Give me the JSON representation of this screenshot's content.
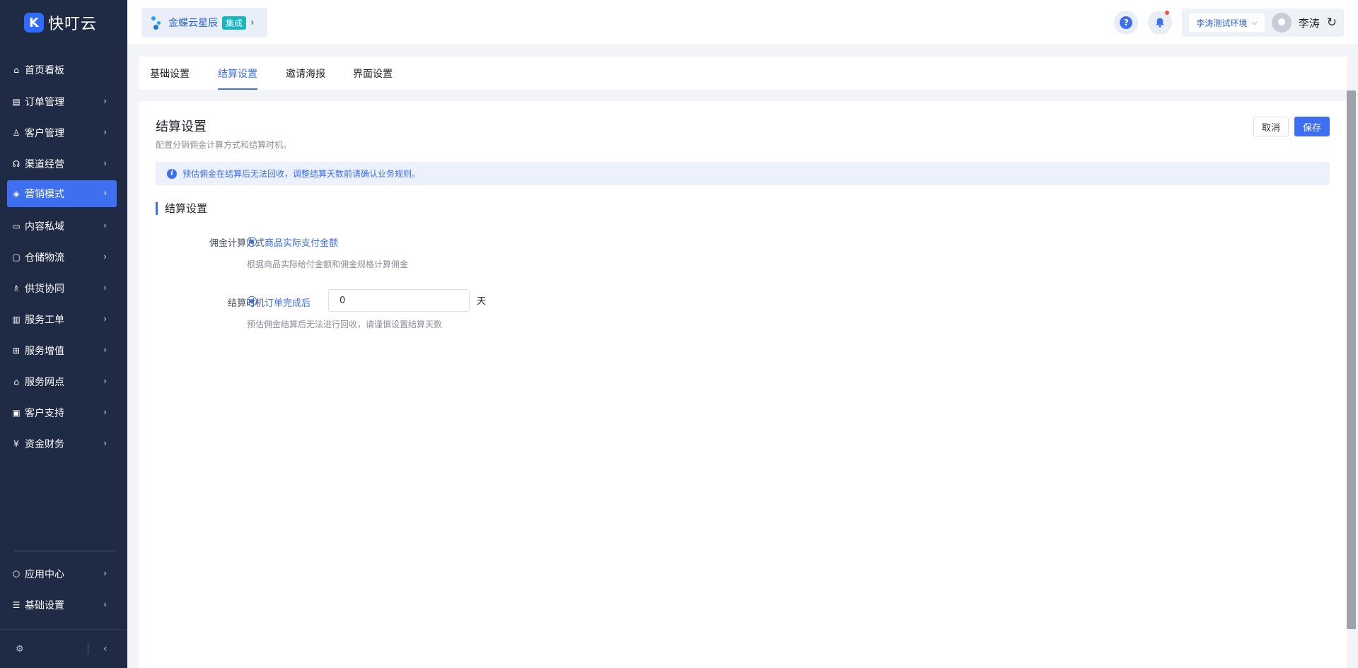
{
  "app": {
    "name": "快叮云",
    "logo_letter": "K"
  },
  "org": {
    "name": "金蝶云星辰",
    "badge": "集成"
  },
  "header": {
    "help_glyph": "?",
    "environment": "李涛测试环境",
    "user_name": "李涛"
  },
  "sidebar": {
    "items": [
      {
        "label": "首页看板",
        "icon": "home-icon",
        "has_children": false
      },
      {
        "label": "订单管理",
        "icon": "clipboard-icon",
        "has_children": true
      },
      {
        "label": "客户管理",
        "icon": "user-icon",
        "has_children": true
      },
      {
        "label": "渠道经营",
        "icon": "channel-icon",
        "has_children": true
      },
      {
        "label": "营销模式",
        "icon": "tag-icon",
        "has_children": true,
        "active": true
      },
      {
        "label": "内容私域",
        "icon": "image-icon",
        "has_children": true
      },
      {
        "label": "仓储物流",
        "icon": "box-icon",
        "has_children": true
      },
      {
        "label": "供货协同",
        "icon": "supply-icon",
        "has_children": true
      },
      {
        "label": "服务工单",
        "icon": "ticket-icon",
        "has_children": true
      },
      {
        "label": "服务增值",
        "icon": "bag-icon",
        "has_children": true
      },
      {
        "label": "服务网点",
        "icon": "store-icon",
        "has_children": true
      },
      {
        "label": "客户支持",
        "icon": "support-icon",
        "has_children": true
      },
      {
        "label": "资金财务",
        "icon": "yuan-icon",
        "has_children": true
      }
    ],
    "bottom_items": [
      {
        "label": "应用中心",
        "icon": "cube-icon",
        "has_children": true
      },
      {
        "label": "基础设置",
        "icon": "sliders-icon",
        "has_children": true
      }
    ]
  },
  "tabs": [
    {
      "label": "基础设置",
      "active": false
    },
    {
      "label": "结算设置",
      "active": true
    },
    {
      "label": "邀请海报",
      "active": false
    },
    {
      "label": "界面设置",
      "active": false
    }
  ],
  "page": {
    "title": "结算设置",
    "subtitle": "配置分销佣金计算方式和结算时机。",
    "cancel_label": "取消",
    "save_label": "保存",
    "alert": "预估佣金在结算后无法回收，调整结算天数前请确认业务规则。",
    "section_title": "结算设置",
    "commission_method": {
      "label": "佣金计算方式",
      "option": "商品实际支付金额",
      "hint": "根据商品实际给付金额和佣金规格计算佣金"
    },
    "settlement_timing": {
      "label": "结算时机",
      "option": "订单完成后",
      "days_value": "0",
      "unit": "天",
      "hint": "预估佣金结算后无法进行回收，请谨慎设置结算天数"
    }
  },
  "colors": {
    "primary": "#3d6ff0",
    "sidebar_bg": "#1f2a44",
    "badge": "#16b7c1",
    "notification": "#ff4d3d"
  }
}
